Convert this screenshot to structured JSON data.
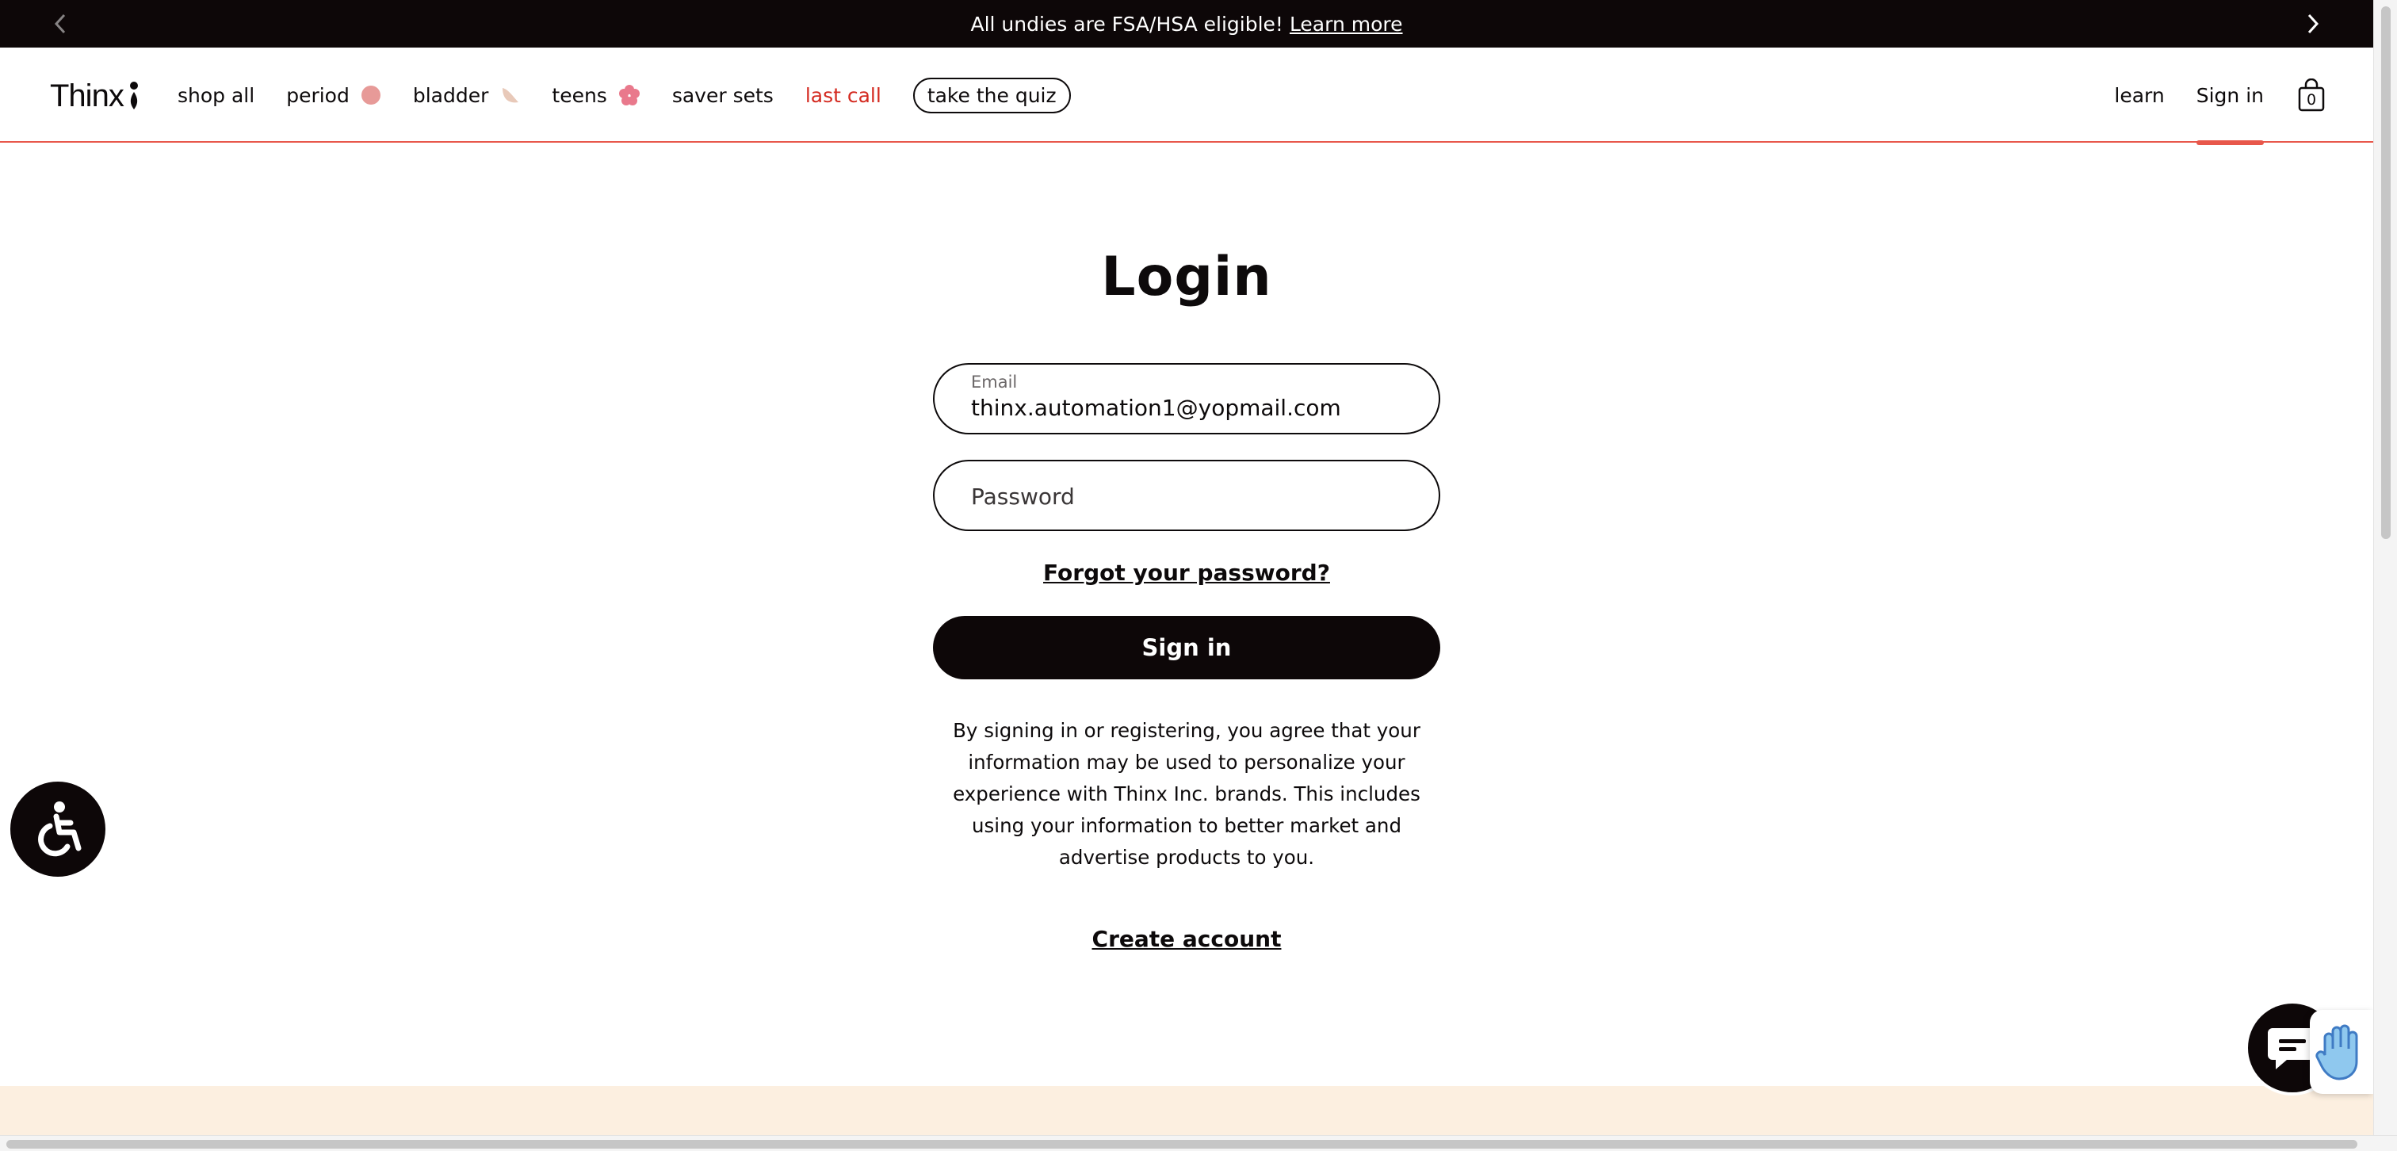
{
  "announcement": {
    "text": "All undies are FSA/HSA eligible!",
    "link": "Learn more"
  },
  "header": {
    "logo": "Thinx",
    "nav": [
      {
        "label": "shop all"
      },
      {
        "label": "period"
      },
      {
        "label": "bladder"
      },
      {
        "label": "teens"
      },
      {
        "label": "saver sets"
      },
      {
        "label": "last call"
      }
    ],
    "quiz_label": "take the quiz",
    "learn_label": "learn",
    "signin_label": "Sign in",
    "cart_count": "0"
  },
  "login": {
    "title": "Login",
    "email_label": "Email",
    "email_value": "thinx.automation1@yopmail.com",
    "password_placeholder": "Password",
    "forgot_label": "Forgot your password?",
    "submit_label": "Sign in",
    "disclaimer": "By signing in or registering, you agree that your information may be used to personalize your experience with Thinx Inc. brands. This includes using your information to better market and advertise products to you.",
    "create_account_label": "Create account"
  },
  "colors": {
    "accent_red": "#e8574b",
    "sale_red": "#d42a20",
    "dark": "#0d0708",
    "footer_band": "#fcefe0",
    "period_dot": "#e79a98",
    "teens_flower": "#e9798c",
    "bladder_leaf": "#e8c9b9"
  },
  "icons": {
    "prev": "chevron-left-icon",
    "next": "chevron-right-icon",
    "cart": "shopping-bag-icon",
    "accessibility": "wheelchair-icon",
    "chat": "chat-bubble-icon",
    "hand": "hand-icon"
  }
}
